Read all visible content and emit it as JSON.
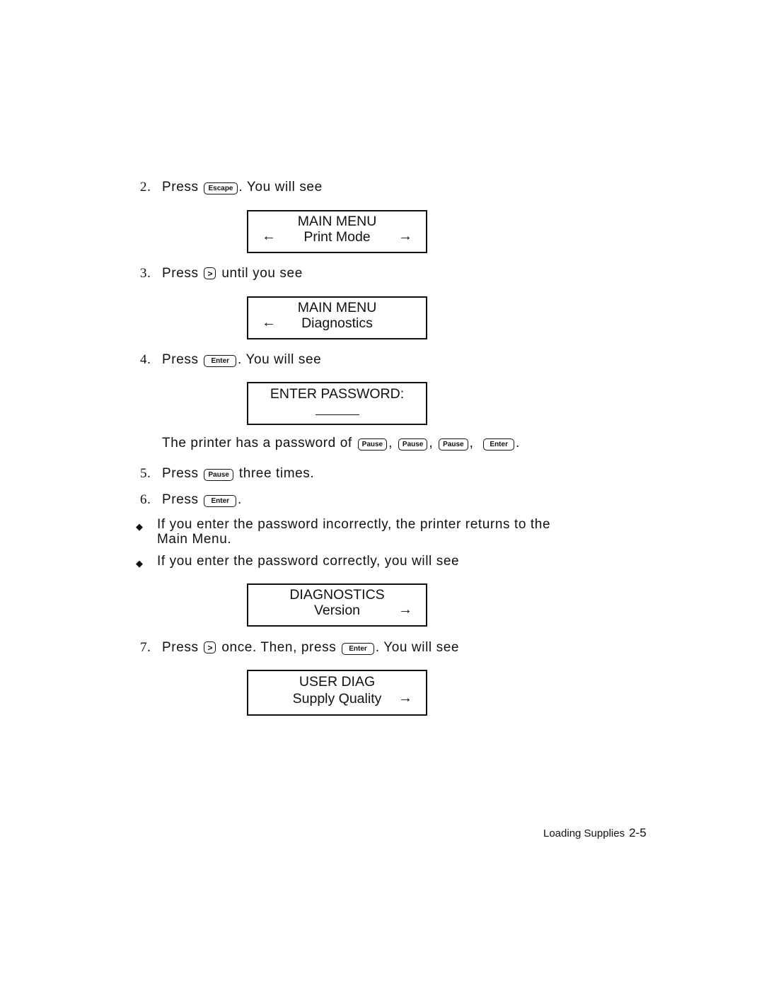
{
  "steps": [
    {
      "number": "2.",
      "before": "Press",
      "key": "Escape",
      "after": ".  You will see"
    },
    {
      "number": "3.",
      "before": "Press",
      "key": ">",
      "after": "until you see"
    },
    {
      "number": "4.",
      "before": "Press",
      "key": "Enter",
      "after": ".  You will see"
    },
    {
      "number": "5.",
      "before": "Press",
      "key": "Pause",
      "after": "three times."
    },
    {
      "number": "6.",
      "before": "Press",
      "key": "Enter",
      "after": "."
    },
    {
      "number": "7.",
      "before": "Press",
      "key": ">",
      "middle": "once.  Then, press",
      "key2": "Enter",
      "after": ".  You will see"
    }
  ],
  "password_note": {
    "text": "The printer has a password of",
    "keys": [
      "Pause",
      "Pause",
      "Pause",
      "Enter"
    ],
    "separator": ",",
    "end": "."
  },
  "displays": [
    {
      "line1": "MAIN MENU",
      "line2": "Print Mode",
      "left_arrow": "←",
      "right_arrow": "→"
    },
    {
      "line1": "MAIN MENU",
      "line2": "Diagnostics",
      "left_arrow": "←"
    },
    {
      "line1": "ENTER PASSWORD:"
    },
    {
      "line1": "DIAGNOSTICS",
      "line2": "Version",
      "right_arrow": "→"
    },
    {
      "line1": "USER DIAG",
      "line2": "Supply Quality",
      "right_arrow": "→"
    }
  ],
  "bullets": [
    {
      "symbol": "◆",
      "line1": "If you enter the password incorrectly, the printer returns to the",
      "line2": "Main Menu."
    },
    {
      "symbol": "◆",
      "line1": "If you enter the password correctly, you will see"
    }
  ],
  "footer": {
    "section": "Loading Supplies",
    "page": "2-5"
  }
}
